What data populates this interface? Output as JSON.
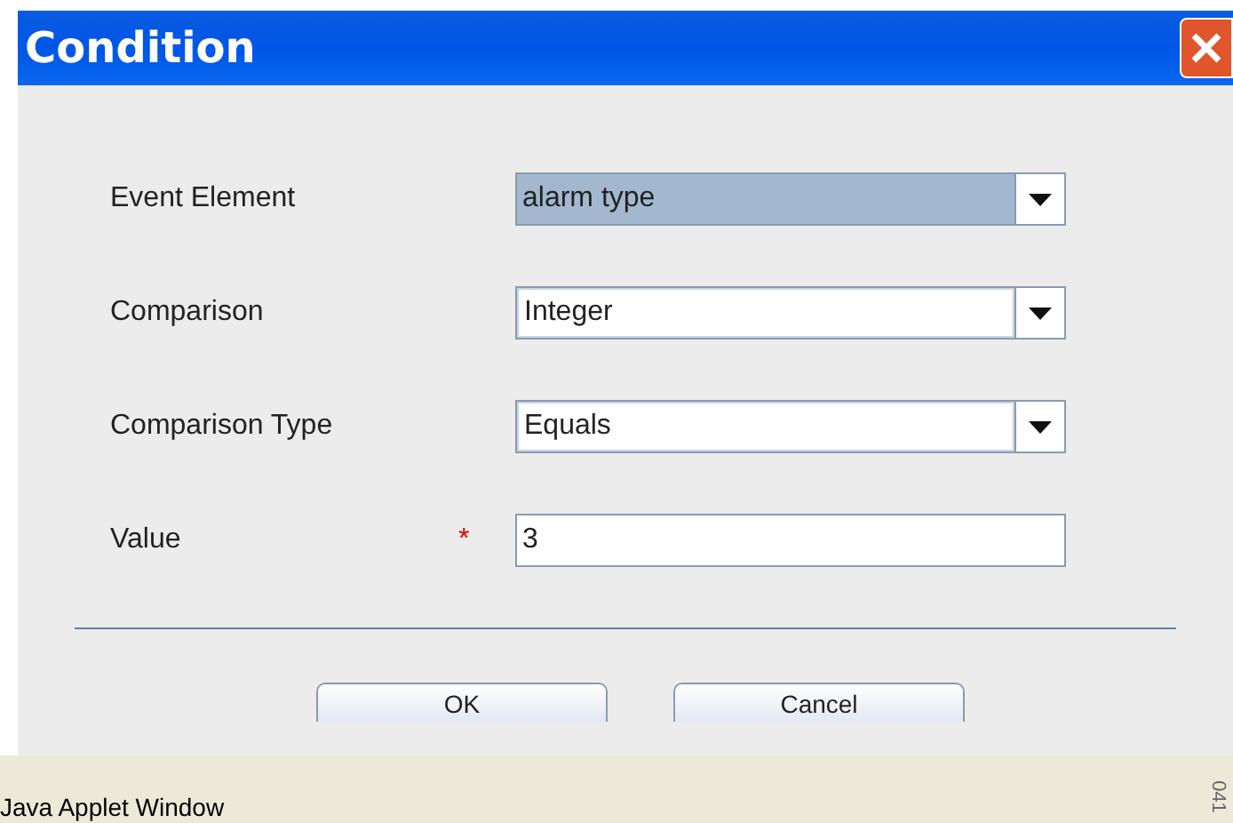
{
  "window": {
    "title": "Condition"
  },
  "fields": [
    {
      "label": "Event Element",
      "kind": "dropdown",
      "value": "alarm type",
      "focused": true
    },
    {
      "label": "Comparison",
      "kind": "dropdown",
      "value": "Integer",
      "focused": false
    },
    {
      "label": "Comparison Type",
      "kind": "dropdown",
      "value": "Equals",
      "focused": false
    },
    {
      "label": "Value",
      "kind": "text",
      "value": "3",
      "focused": false,
      "required_mark": "*"
    }
  ],
  "buttons": [
    "OK",
    "Cancel"
  ],
  "status_bar": {
    "text": "Java Applet Window",
    "side_code": "041"
  }
}
